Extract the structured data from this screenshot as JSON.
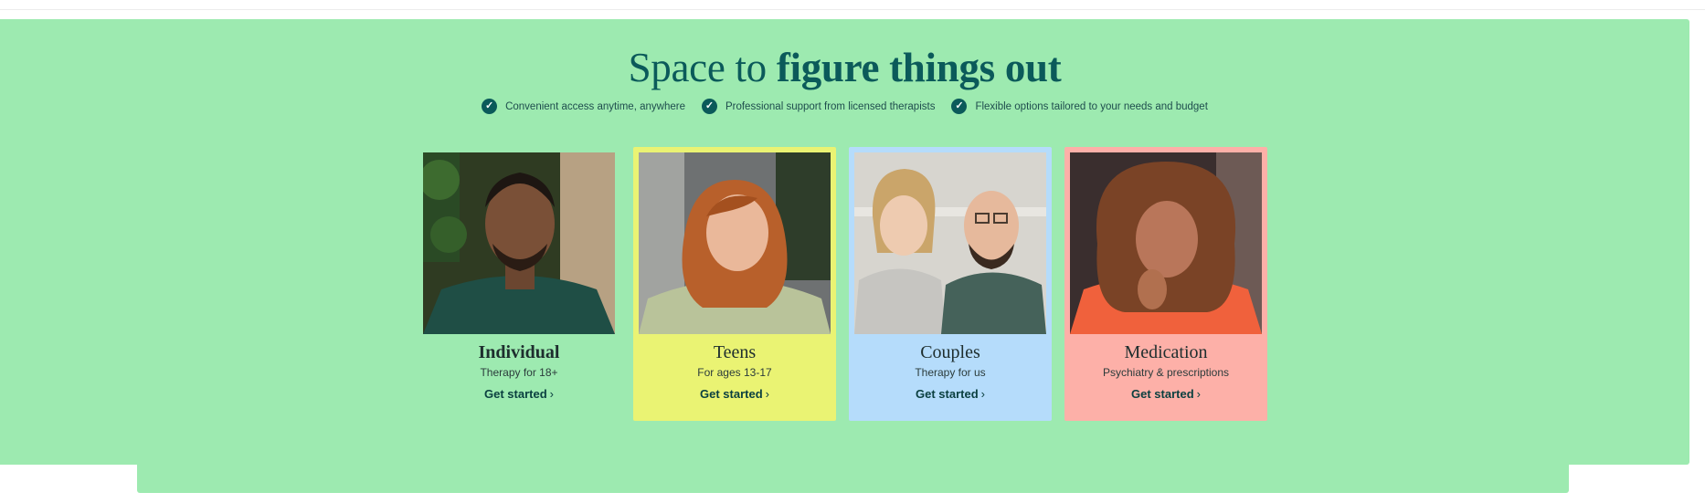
{
  "hero": {
    "headline_plain": "Space to ",
    "headline_emphasis": "figure things out"
  },
  "features": [
    "Convenient access anytime, anywhere",
    "Professional support from licensed therapists",
    "Flexible options tailored to your needs and budget"
  ],
  "cards": [
    {
      "title": "Individual",
      "subtitle": "Therapy for 18+",
      "cta": "Get started"
    },
    {
      "title": "Teens",
      "subtitle": "For ages 13-17",
      "cta": "Get started"
    },
    {
      "title": "Couples",
      "subtitle": "Therapy for us",
      "cta": "Get started"
    },
    {
      "title": "Medication",
      "subtitle": "Psychiatry & prescriptions",
      "cta": "Get started"
    }
  ],
  "colors": {
    "section_bg": "#9deab0",
    "brand_dark": "#0b5a5a",
    "teens_card": "#eaf373",
    "couples_card": "#b5dcfb",
    "medication_card": "#fdb0a8"
  },
  "icons": {
    "feature_bullet": "check-circle-icon",
    "cta_arrow": "chevron-right-icon"
  }
}
